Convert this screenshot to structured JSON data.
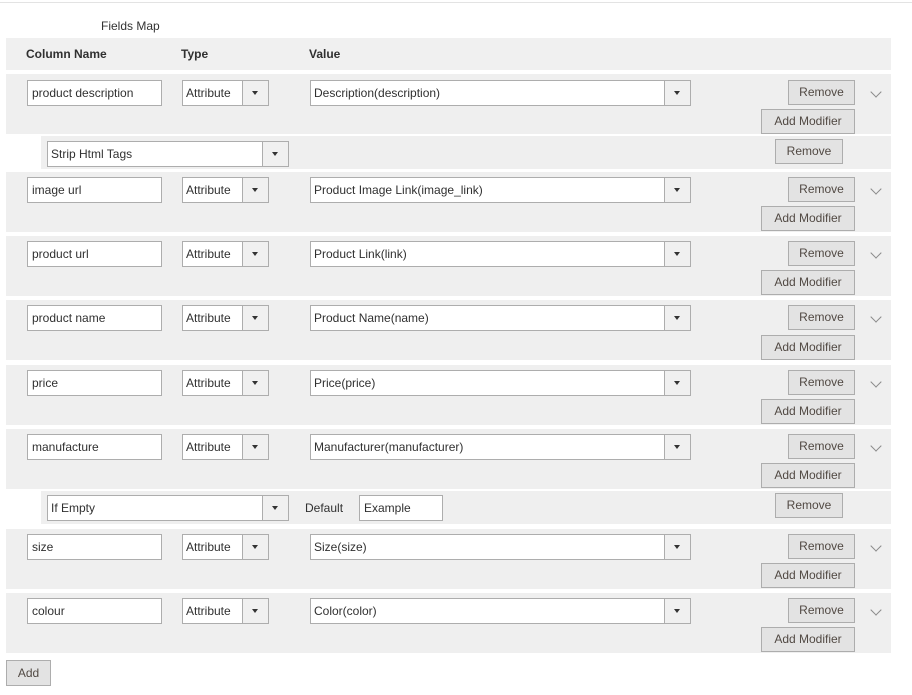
{
  "title": "Fields Map",
  "headers": {
    "column_name": "Column Name",
    "type": "Type",
    "value": "Value"
  },
  "labels": {
    "remove": "Remove",
    "add_modifier": "Add Modifier",
    "add": "Add",
    "default": "Default"
  },
  "rows": [
    {
      "column": "product description",
      "type": "Attribute",
      "value": "Description(description)"
    },
    {
      "column": "image url",
      "type": "Attribute",
      "value": "Product Image Link(image_link)"
    },
    {
      "column": "product url",
      "type": "Attribute",
      "value": "Product Link(link)"
    },
    {
      "column": "product name",
      "type": "Attribute",
      "value": "Product Name(name)"
    },
    {
      "column": "price",
      "type": "Attribute",
      "value": "Price(price)"
    },
    {
      "column": "manufacture",
      "type": "Attribute",
      "value": "Manufacturer(manufacturer)"
    },
    {
      "column": "size",
      "type": "Attribute",
      "value": "Size(size)"
    },
    {
      "column": "colour",
      "type": "Attribute",
      "value": "Color(color)"
    }
  ],
  "modifiers": [
    {
      "name": "Strip Html Tags"
    },
    {
      "name": "If Empty",
      "default_value": "Example"
    }
  ],
  "icons": {
    "expand": "chevron-down-icon",
    "dropdown": "dropdown-arrow-icon"
  }
}
